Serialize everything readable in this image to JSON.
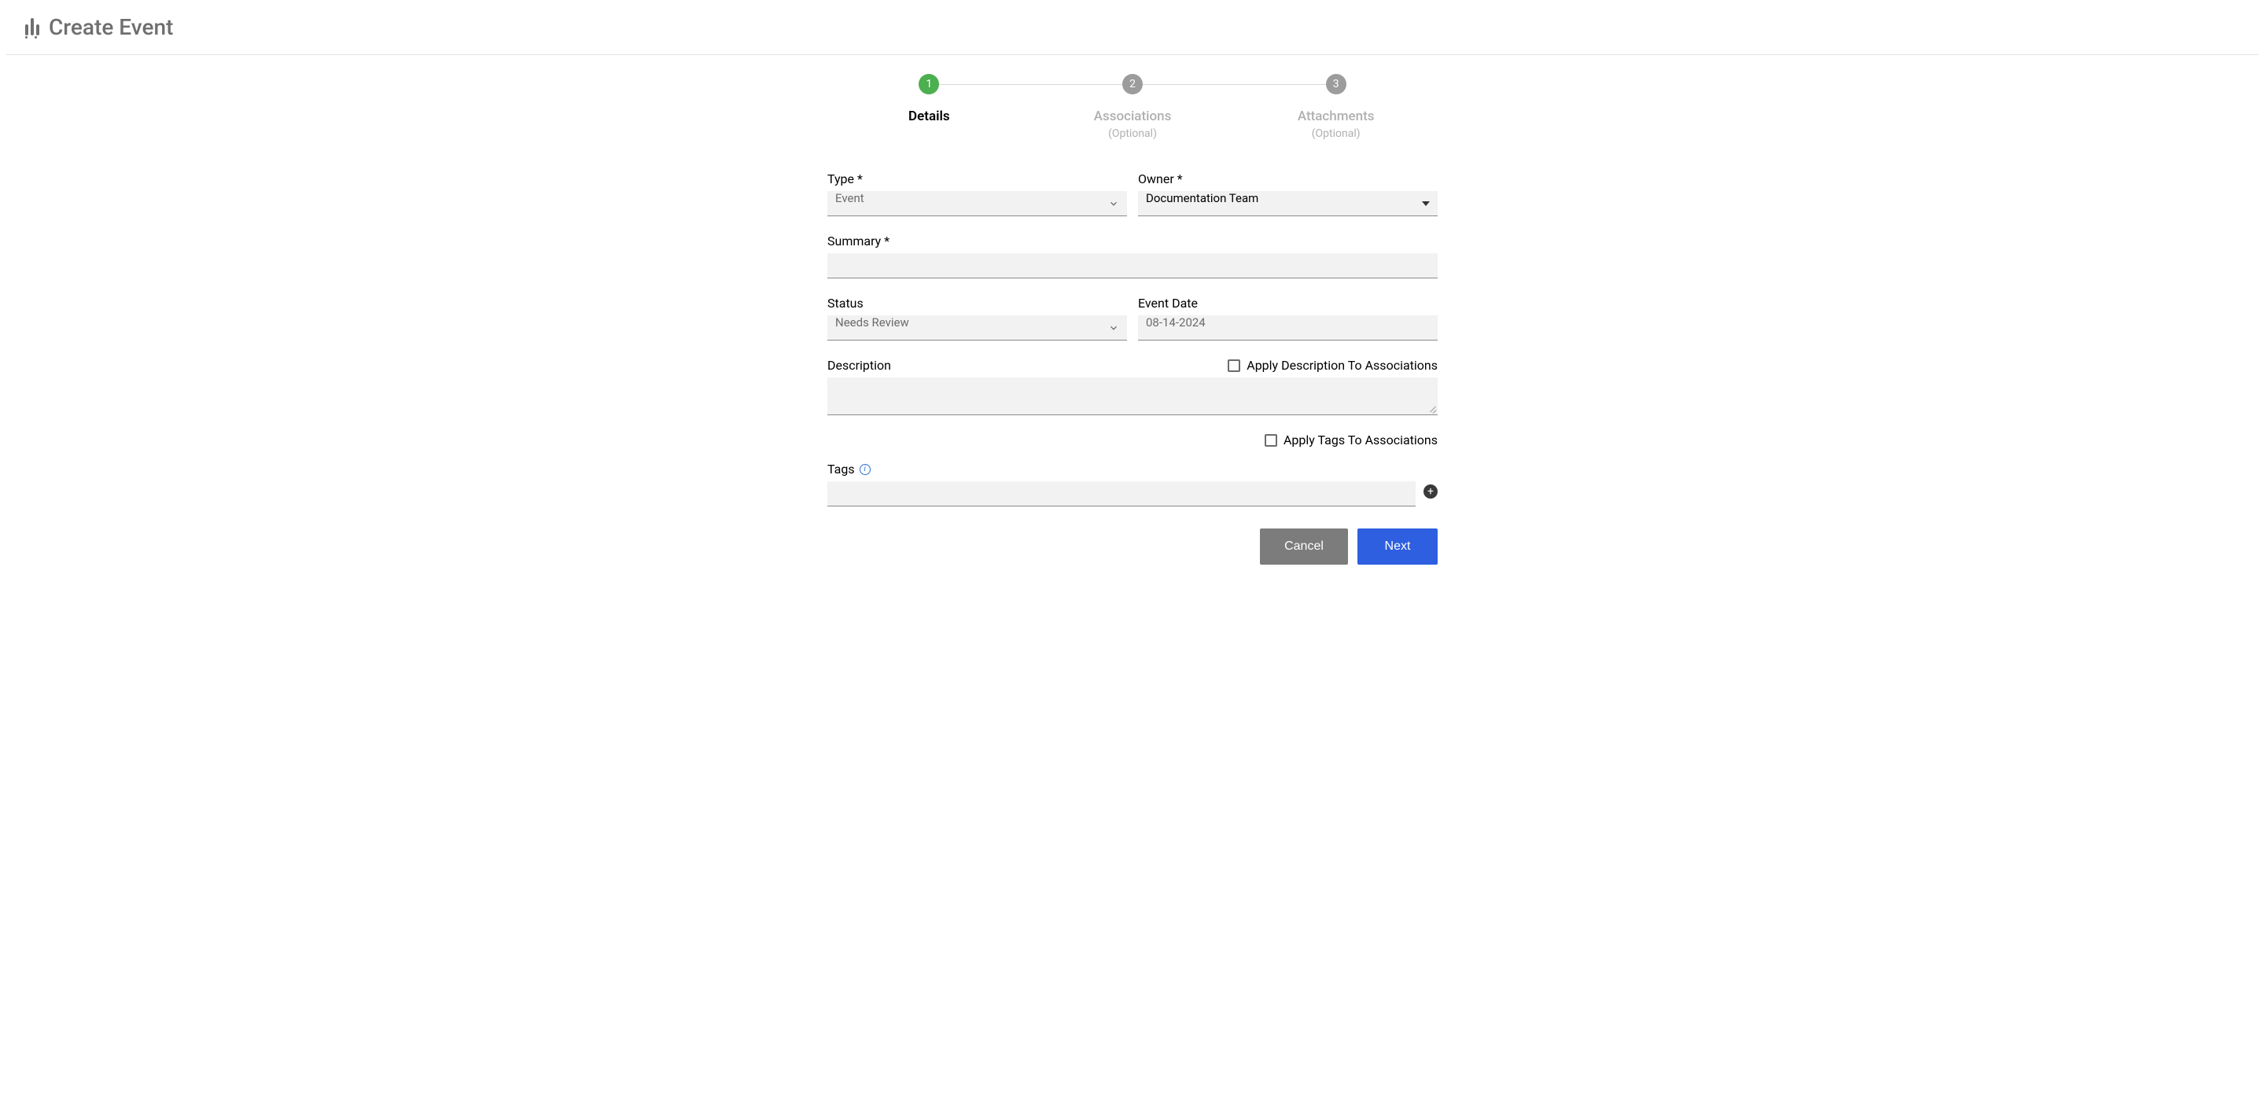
{
  "header": {
    "title": "Create Event"
  },
  "stepper": {
    "steps": [
      {
        "num": "1",
        "label": "Details",
        "sublabel": ""
      },
      {
        "num": "2",
        "label": "Associations",
        "sublabel": "(Optional)"
      },
      {
        "num": "3",
        "label": "Attachments",
        "sublabel": "(Optional)"
      }
    ]
  },
  "form": {
    "type": {
      "label": "Type *",
      "value": "Event"
    },
    "owner": {
      "label": "Owner *",
      "value": "Documentation Team"
    },
    "summary": {
      "label": "Summary *",
      "value": ""
    },
    "status": {
      "label": "Status",
      "value": "Needs Review"
    },
    "event_date": {
      "label": "Event Date",
      "value": "08-14-2024"
    },
    "description": {
      "label": "Description",
      "checkbox_label": "Apply Description To Associations",
      "value": ""
    },
    "tags_apply": {
      "checkbox_label": "Apply Tags To Associations"
    },
    "tags": {
      "label": "Tags",
      "value": ""
    }
  },
  "buttons": {
    "cancel": "Cancel",
    "next": "Next"
  }
}
